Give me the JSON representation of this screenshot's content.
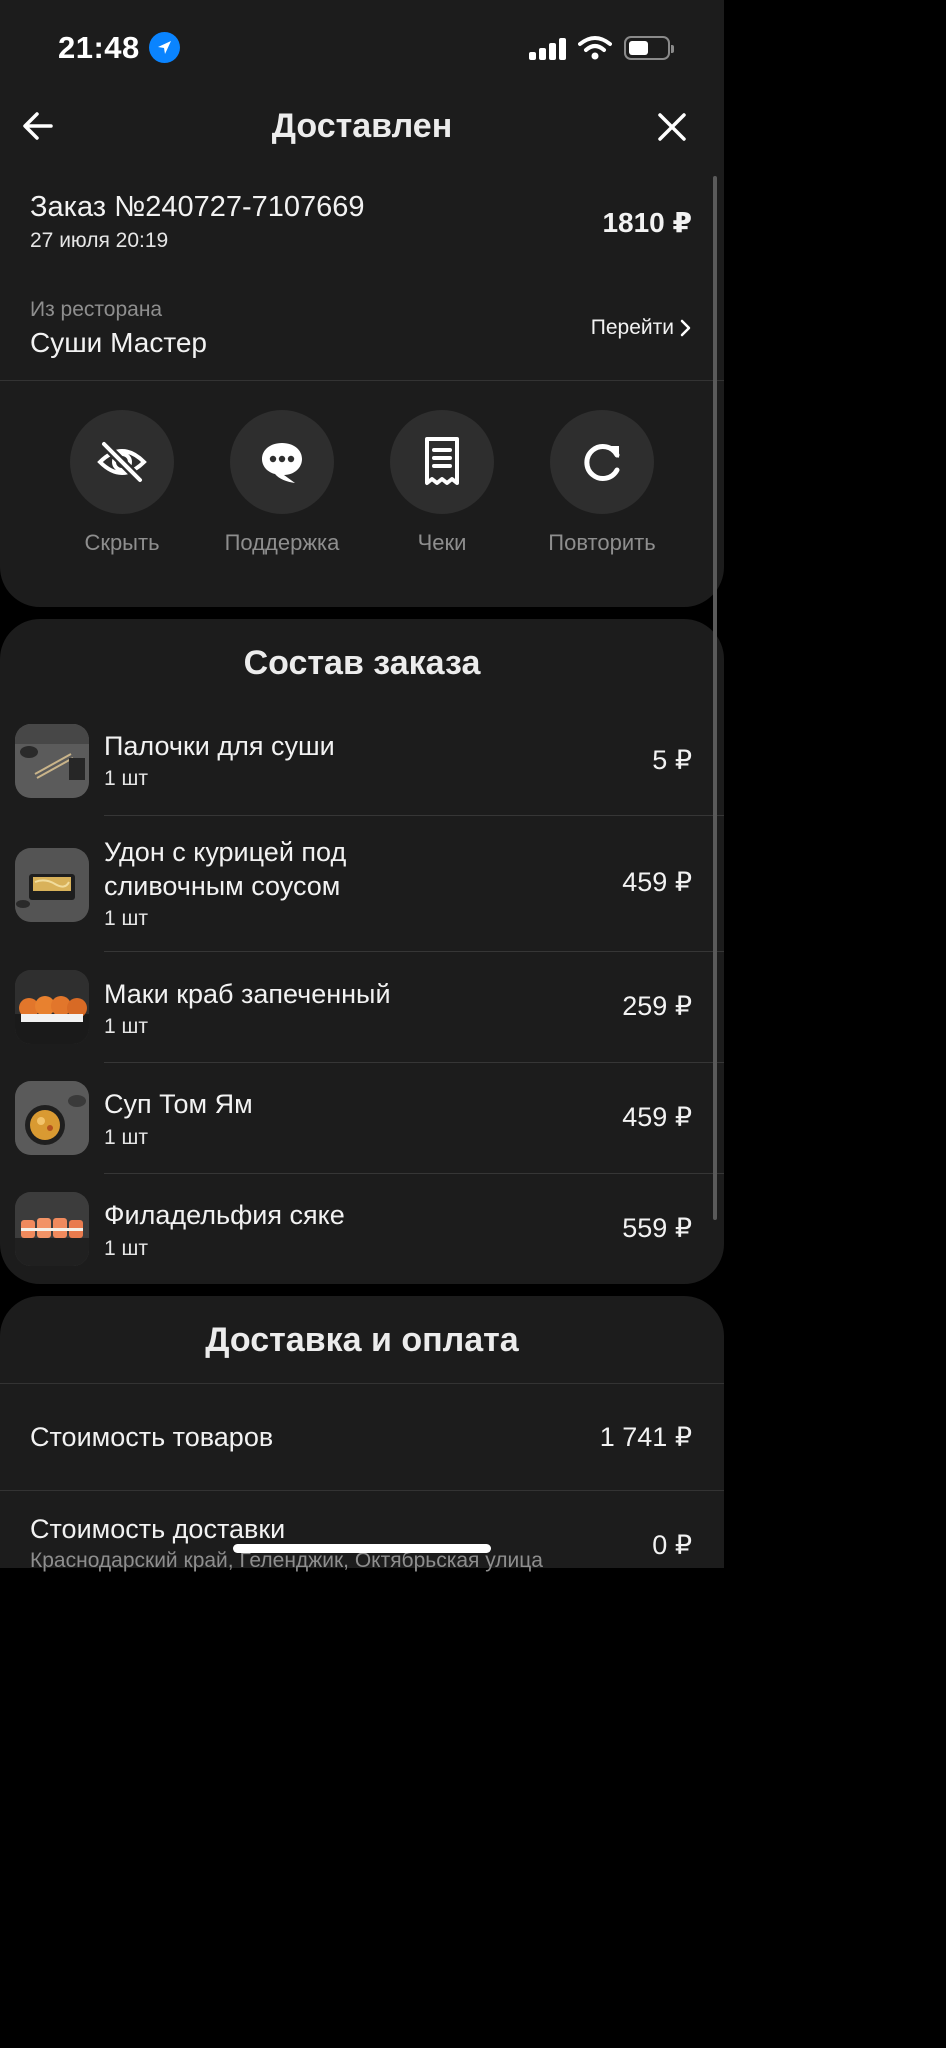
{
  "status_bar": {
    "time": "21:48"
  },
  "header": {
    "title": "Доставлен"
  },
  "order": {
    "number": "Заказ №240727-7107669",
    "date": "27 июля 20:19",
    "total": "1810 ₽"
  },
  "restaurant": {
    "caption": "Из ресторана",
    "name": "Суши Мастер",
    "goto_label": "Перейти"
  },
  "actions": [
    {
      "label": "Скрыть",
      "icon": "eye-off-icon"
    },
    {
      "label": "Поддержка",
      "icon": "chat-bubble-icon"
    },
    {
      "label": "Чеки",
      "icon": "receipt-icon"
    },
    {
      "label": "Повторить",
      "icon": "refresh-icon"
    }
  ],
  "composition": {
    "title": "Состав заказа",
    "items": [
      {
        "name": "Палочки для суши",
        "qty": "1 шт",
        "price": "5 ₽"
      },
      {
        "name_line1": "Удон с курицей под",
        "name_line2": "сливочным соусом",
        "qty": "1 шт",
        "price": "459 ₽"
      },
      {
        "name": "Маки краб запеченный",
        "qty": "1 шт",
        "price": "259 ₽"
      },
      {
        "name": "Суп Том Ям",
        "qty": "1 шт",
        "price": "459 ₽"
      },
      {
        "name": "Филадельфия сяке",
        "qty": "1 шт",
        "price": "559 ₽"
      }
    ]
  },
  "delivery_payment": {
    "title": "Доставка и оплата",
    "goods_label": "Стоимость товаров",
    "goods_value": "1 741 ₽",
    "delivery_label": "Стоимость доставки",
    "delivery_value": "0 ₽",
    "address": "Краснодарский край, Геленджик, Октябрьская улица"
  },
  "colors": {
    "background": "#000000",
    "card": "#1c1c1c",
    "button": "#2e2e2e",
    "muted_text": "#8e8e8e",
    "location_accent": "#0a84ff"
  }
}
